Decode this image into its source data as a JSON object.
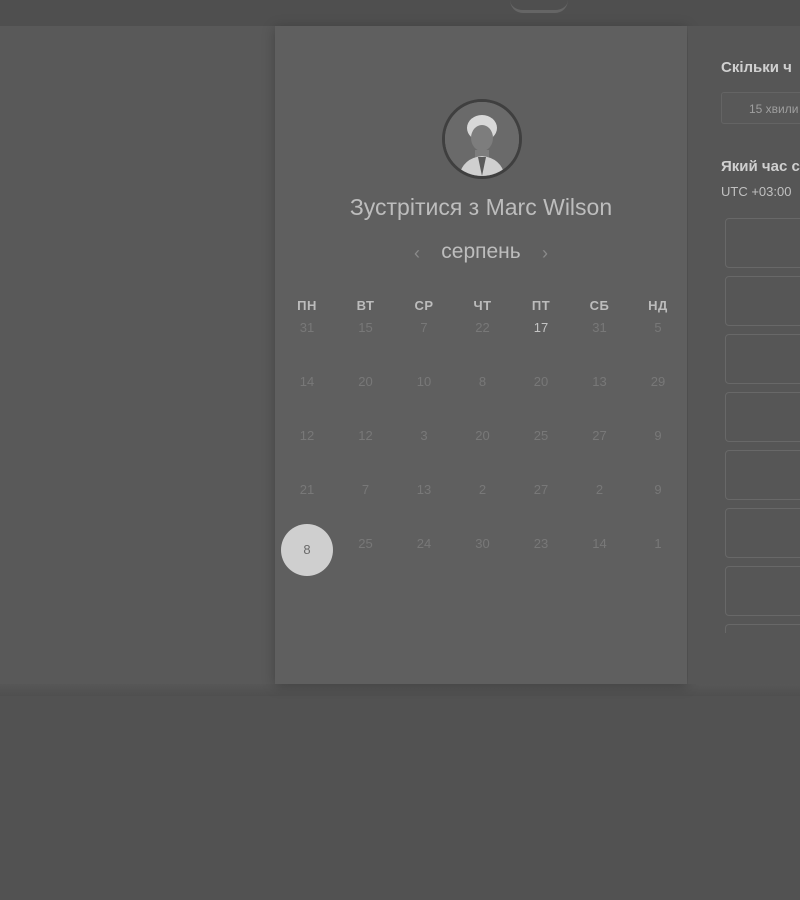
{
  "booking": {
    "title": "Зустрітися з Marc Wilson",
    "month": "серпень",
    "prev_arrow": "‹",
    "next_arrow": "›",
    "weekdays": [
      "ПН",
      "ВТ",
      "СР",
      "ЧТ",
      "ПТ",
      "СБ",
      "НД"
    ],
    "weeks": [
      [
        "31",
        "15",
        "7",
        "22",
        "17",
        "31",
        "5"
      ],
      [
        "14",
        "20",
        "10",
        "8",
        "20",
        "13",
        "29"
      ],
      [
        "12",
        "12",
        "3",
        "20",
        "25",
        "27",
        "9"
      ],
      [
        "21",
        "7",
        "13",
        "2",
        "27",
        "2",
        "9"
      ],
      [
        "8",
        "25",
        "24",
        "30",
        "23",
        "14",
        "1"
      ]
    ],
    "selected_day": "8",
    "highlighted_day": "17"
  },
  "side_panel": {
    "duration_heading": "Скільки ч",
    "duration_value": "15 хвили",
    "time_heading": "Який час с",
    "timezone": "UTC +03:00",
    "slots_count_visible": 8
  },
  "colors": {
    "background": "#525252",
    "card": "#5f5f5f",
    "selected": "#cfcfcf"
  }
}
